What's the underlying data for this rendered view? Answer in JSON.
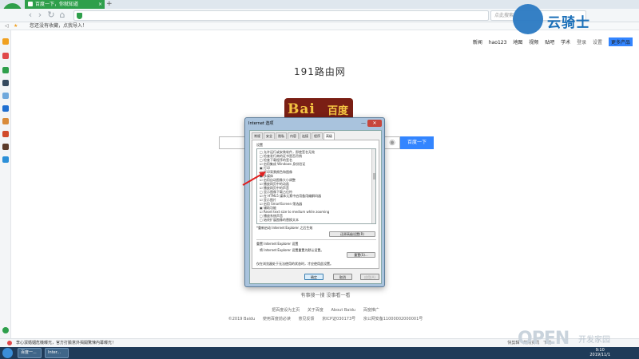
{
  "browser": {
    "tab_title": "百度一下，你就知道",
    "tab_close": "×",
    "new_tab": "+",
    "nav": {
      "back": "‹",
      "forward": "›",
      "reload": "↻",
      "home": "⌂"
    },
    "search_placeholder": "点此搜索"
  },
  "bookmarks": {
    "prefix": "◁",
    "text": "您还没有收藏，点我导入！"
  },
  "page": {
    "top_links": [
      "新闻",
      "hao123",
      "地图",
      "视频",
      "贴吧",
      "学术",
      "登录",
      "设置"
    ],
    "more_products": "更多产品",
    "site_title": "191路由网",
    "logo_left": "Bai",
    "logo_right": "百度",
    "search_button": "百度一下",
    "footer_links_1": [
      "把百度设为主页",
      "关于百度",
      "About Baidu",
      "百度推广"
    ],
    "footer_links_2": [
      "©2019 Baidu",
      "使用百度前必读",
      "意见反馈",
      "京ICP证030173号",
      "京公网安备11000002000001号"
    ],
    "behind_dialog": "有事搜一搜  没事看一看"
  },
  "dialog": {
    "title": "Internet 选项",
    "close": "✕",
    "minimize": "—",
    "tabs": [
      "常规",
      "安全",
      "隐私",
      "内容",
      "连接",
      "程序",
      "高级"
    ],
    "active_tab": "高级",
    "settings_label": "设置",
    "tree_items": [
      "□ 允许运行或安装软件，即使签名无效",
      "□ 检查发行商的证书是否吊销",
      "□ 检查下载程序的签名",
      "☑ 启用集成 Windows 身份验证",
      "▣ 打印",
      "  □ 打印背景颜色和图像",
      "▣ 多媒体",
      "  ☑ 启用自动图像大小调整",
      "  ☑ 播放网页中的动画",
      "  ☑ 播放网页中的声音",
      "  □ 显示图像下载占位符",
      "  ☑ 在 HTML5 媒体元素中启用备用编解码器",
      "  ☑ 显示图片",
      "  ☑ 启用 SmartScreen 筛选器",
      "▣ 辅助功能",
      "  ☑ Reset text size to medium while zooming",
      "  □ 播放系统声音",
      "  □ 始终扩展图像的替换文本"
    ],
    "restart_note": "*重新启动 Internet Explorer 之后生效",
    "restore_advanced": "还原高级设置(R)",
    "reset_group_title": "重置 Internet Explorer 设置",
    "reset_desc": "将 Internet Explorer 设置重置为默认设置。",
    "reset_button": "重置(S)...",
    "reset_warning": "仅在浏览器处于无法使用的状态时，才应使用此设置。",
    "ok": "确定",
    "cancel": "取消",
    "apply": "应用(A)"
  },
  "status": {
    "message": "李心潔婚姻危機曝光，官方打臉意外揭開驚悚內幕曝光！",
    "right_items": [
      "快剪辑",
      "热点资讯",
      "下载"
    ]
  },
  "taskbar": {
    "apps": [
      "百度一...",
      "Inter..."
    ],
    "time": "9:10",
    "date": "2019/11/1"
  },
  "watermarks": {
    "top_right": "云骑士",
    "bottom_right_main": "OPEN",
    "bottom_right_sub": "开发家园"
  },
  "colors": {
    "tab_green": "#2e9f4b",
    "baidu_blue": "#3385ff",
    "dialog_frame": "#a9c3dd",
    "arrow_red": "#e02020"
  }
}
